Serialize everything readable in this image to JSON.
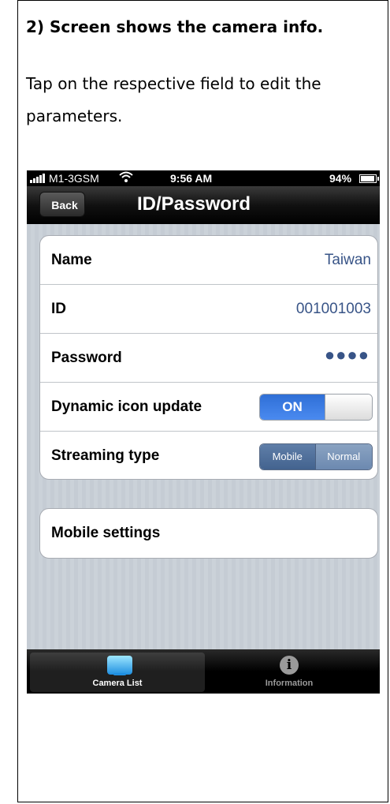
{
  "document": {
    "step_title": "2) Screen shows the camera info.",
    "instruction": "Tap on the respective field to edit the parameters."
  },
  "status_bar": {
    "carrier": "M1-3GSM",
    "time": "9:56 AM",
    "battery": "94%"
  },
  "nav_bar": {
    "back_label": "Back",
    "title": "ID/Password"
  },
  "settings": {
    "name_label": "Name",
    "name_value": "Taiwan",
    "id_label": "ID",
    "id_value": "001001003",
    "password_label": "Password",
    "password_value": "●●●●",
    "dynamic_label": "Dynamic icon update",
    "dynamic_state": "ON",
    "streaming_label": "Streaming type",
    "streaming_options": [
      "Mobile",
      "Normal"
    ],
    "streaming_selected": "Mobile"
  },
  "mobile_settings": {
    "label": "Mobile settings"
  },
  "tab_bar": {
    "tabs": [
      {
        "label": "Camera List",
        "icon": "camera-list-icon",
        "active": true
      },
      {
        "label": "Information",
        "icon": "info-icon",
        "active": false
      }
    ]
  },
  "colors": {
    "value_text": "#385487",
    "toggle_on": "#2f6fd6",
    "segment_selected": "#43638f"
  }
}
